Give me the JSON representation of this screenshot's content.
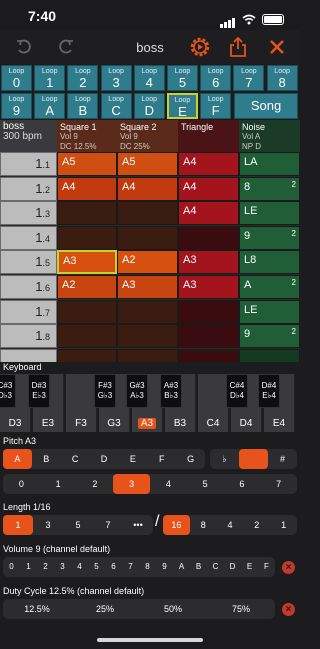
{
  "status": {
    "time": "7:40"
  },
  "toolbar": {
    "song_name": "boss"
  },
  "loops": {
    "caption": "Loop",
    "row1": [
      "0",
      "1",
      "2",
      "3",
      "4",
      "5",
      "6",
      "7",
      "8"
    ],
    "row2": [
      "9",
      "A",
      "B",
      "C",
      "D",
      "E",
      "F"
    ],
    "selected": "E",
    "song_label": "Song"
  },
  "grid": {
    "header": {
      "song_title": "boss",
      "bpm": "300 bpm",
      "columns": [
        {
          "title": "Square 1",
          "sub1": "Vol 9",
          "sub2": "DC 12.5%"
        },
        {
          "title": "Square 2",
          "sub1": "Vol 9",
          "sub2": "DC 25%"
        },
        {
          "title": "Triangle",
          "sub1": "",
          "sub2": ""
        },
        {
          "title": "Noise",
          "sub1": "Vol A",
          "sub2": "NP D"
        }
      ]
    },
    "rows": [
      {
        "major": "1",
        "minor": ".1",
        "cells": [
          "A5",
          "A5",
          "A4",
          "LA"
        ],
        "sup": [
          "",
          "",
          "",
          ""
        ]
      },
      {
        "major": "1",
        "minor": ".2",
        "cells": [
          "A4",
          "A4",
          "A4",
          "8"
        ],
        "sup": [
          "",
          "",
          "",
          "2"
        ]
      },
      {
        "major": "1",
        "minor": ".3",
        "cells": [
          "",
          "",
          "A4",
          "LE"
        ],
        "sup": [
          "",
          "",
          "",
          ""
        ]
      },
      {
        "major": "1",
        "minor": ".4",
        "cells": [
          "",
          "",
          "",
          "9"
        ],
        "sup": [
          "",
          "",
          "",
          "2"
        ]
      },
      {
        "major": "1",
        "minor": ".5",
        "cells": [
          "A3",
          "A2",
          "A3",
          "L8"
        ],
        "sup": [
          "",
          "",
          "",
          ""
        ]
      },
      {
        "major": "1",
        "minor": ".6",
        "cells": [
          "A2",
          "A3",
          "A3",
          "A"
        ],
        "sup": [
          "",
          "",
          "",
          "2"
        ]
      },
      {
        "major": "1",
        "minor": ".7",
        "cells": [
          "",
          "",
          "",
          "LE"
        ],
        "sup": [
          "",
          "",
          "",
          ""
        ]
      },
      {
        "major": "1",
        "minor": ".8",
        "cells": [
          "",
          "",
          "",
          "9"
        ],
        "sup": [
          "",
          "",
          "",
          "2"
        ]
      },
      {
        "major": "",
        "minor": "",
        "cells": [
          "",
          "",
          "",
          ""
        ],
        "sup": [
          "",
          "",
          "",
          ""
        ]
      }
    ]
  },
  "keyboard": {
    "label": "Keyboard",
    "white": [
      "D3",
      "E3",
      "F3",
      "G3",
      "A3",
      "B3",
      "C4",
      "D4",
      "E4"
    ],
    "active": "A3",
    "black": [
      {
        "a": "C#3",
        "b": "D♭3"
      },
      {
        "a": "D#3",
        "b": "E♭3"
      },
      {
        "a": "F#3",
        "b": "G♭3"
      },
      {
        "a": "G#3",
        "b": "A♭3"
      },
      {
        "a": "A#3",
        "b": "B♭3"
      },
      {
        "a": "C#4",
        "b": "D♭4"
      },
      {
        "a": "D#4",
        "b": "E♭4"
      }
    ]
  },
  "pitch": {
    "label": "Pitch A3",
    "notes": [
      "A",
      "B",
      "C",
      "D",
      "E",
      "F",
      "G"
    ],
    "accidentals": [
      "♭",
      "",
      "#"
    ],
    "octaves": [
      "0",
      "1",
      "2",
      "3",
      "4",
      "5",
      "6",
      "7"
    ],
    "active_note": "A",
    "active_octave": "3"
  },
  "length": {
    "label": "Length 1/16",
    "numerators": [
      "1",
      "3",
      "5",
      "7",
      "•••"
    ],
    "denominators": [
      "16",
      "8",
      "4",
      "2",
      "1"
    ]
  },
  "volume": {
    "label": "Volume 9 (channel default)",
    "values": [
      "0",
      "1",
      "2",
      "3",
      "4",
      "5",
      "6",
      "7",
      "8",
      "9",
      "A",
      "B",
      "C",
      "D",
      "E",
      "F"
    ]
  },
  "duty": {
    "label": "Duty Cycle 12.5% (channel default)",
    "values": [
      "12.5%",
      "25%",
      "50%",
      "75%"
    ]
  },
  "colors": {
    "accent": "#e8531c",
    "loop": "#2f7c8c",
    "square": "#c2410f",
    "triangle": "#a3141c",
    "noise": "#1f5e36"
  }
}
